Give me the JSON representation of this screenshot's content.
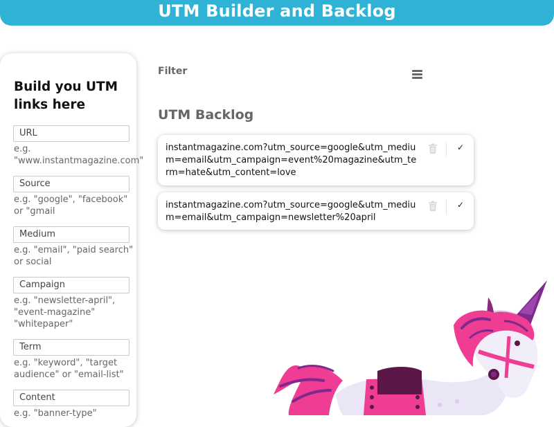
{
  "header": {
    "title": "UTM Builder and Backlog"
  },
  "builder": {
    "heading": "Build you UTM links here",
    "fields": [
      {
        "label": "URL",
        "hint": "e.g. \"www.instantmagazine.com\""
      },
      {
        "label": "Source",
        "hint": "e.g. \"google\", \"facebook\" or \"gmail"
      },
      {
        "label": "Medium",
        "hint": "e.g. \"email\", \"paid search\" or social"
      },
      {
        "label": "Campaign",
        "hint": "e.g. \"newsletter-april\", \"event-magazine\" \"whitepaper\""
      },
      {
        "label": "Term",
        "hint": "e.g. \"keyword\", \"target audience\" or \"email-list\""
      },
      {
        "label": "Content",
        "hint": "e.g. \"banner-type\""
      }
    ]
  },
  "filter": {
    "label": "Filter"
  },
  "backlog": {
    "title": "UTM Backlog",
    "items": [
      {
        "url": "instantmagazine.com?utm_source=google&utm_medium=email&utm_campaign=event%20magazine&utm_term=hate&utm_content=love"
      },
      {
        "url": "instantmagazine.com?utm_source=google&utm_medium=email&utm_campaign=newsletter%20april"
      }
    ]
  },
  "icons": {
    "menu": "hamburger-icon",
    "delete": "trash-icon",
    "done": "check-icon",
    "mascot": "unicorn-illustration"
  },
  "colors": {
    "header": "#2fb2d5",
    "unicorn_pink": "#ee3d93",
    "unicorn_purple": "#7d2a8c"
  }
}
